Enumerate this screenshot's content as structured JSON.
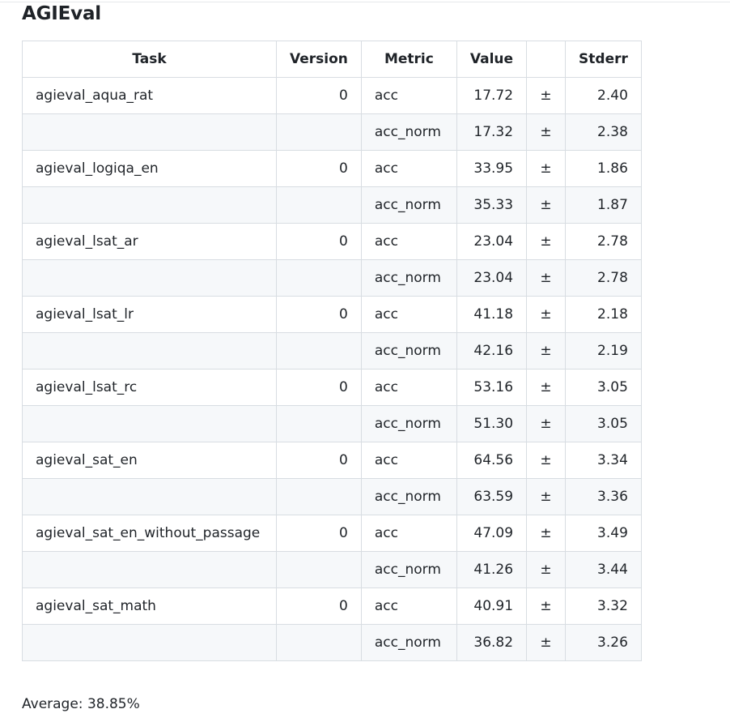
{
  "section_title": "AGIEval",
  "columns": [
    "Task",
    "Version",
    "Metric",
    "Value",
    "",
    "Stderr"
  ],
  "rows": [
    {
      "task": "agieval_aqua_rat",
      "version": "0",
      "metric": "acc",
      "value": "17.72",
      "pm": "±",
      "stderr": "2.40"
    },
    {
      "task": "",
      "version": "",
      "metric": "acc_norm",
      "value": "17.32",
      "pm": "±",
      "stderr": "2.38"
    },
    {
      "task": "agieval_logiqa_en",
      "version": "0",
      "metric": "acc",
      "value": "33.95",
      "pm": "±",
      "stderr": "1.86"
    },
    {
      "task": "",
      "version": "",
      "metric": "acc_norm",
      "value": "35.33",
      "pm": "±",
      "stderr": "1.87"
    },
    {
      "task": "agieval_lsat_ar",
      "version": "0",
      "metric": "acc",
      "value": "23.04",
      "pm": "±",
      "stderr": "2.78"
    },
    {
      "task": "",
      "version": "",
      "metric": "acc_norm",
      "value": "23.04",
      "pm": "±",
      "stderr": "2.78"
    },
    {
      "task": "agieval_lsat_lr",
      "version": "0",
      "metric": "acc",
      "value": "41.18",
      "pm": "±",
      "stderr": "2.18"
    },
    {
      "task": "",
      "version": "",
      "metric": "acc_norm",
      "value": "42.16",
      "pm": "±",
      "stderr": "2.19"
    },
    {
      "task": "agieval_lsat_rc",
      "version": "0",
      "metric": "acc",
      "value": "53.16",
      "pm": "±",
      "stderr": "3.05"
    },
    {
      "task": "",
      "version": "",
      "metric": "acc_norm",
      "value": "51.30",
      "pm": "±",
      "stderr": "3.05"
    },
    {
      "task": "agieval_sat_en",
      "version": "0",
      "metric": "acc",
      "value": "64.56",
      "pm": "±",
      "stderr": "3.34"
    },
    {
      "task": "",
      "version": "",
      "metric": "acc_norm",
      "value": "63.59",
      "pm": "±",
      "stderr": "3.36"
    },
    {
      "task": "agieval_sat_en_without_passage",
      "version": "0",
      "metric": "acc",
      "value": "47.09",
      "pm": "±",
      "stderr": "3.49"
    },
    {
      "task": "",
      "version": "",
      "metric": "acc_norm",
      "value": "41.26",
      "pm": "±",
      "stderr": "3.44"
    },
    {
      "task": "agieval_sat_math",
      "version": "0",
      "metric": "acc",
      "value": "40.91",
      "pm": "±",
      "stderr": "3.32"
    },
    {
      "task": "",
      "version": "",
      "metric": "acc_norm",
      "value": "36.82",
      "pm": "±",
      "stderr": "3.26"
    }
  ],
  "average_text": "Average: 38.85%"
}
